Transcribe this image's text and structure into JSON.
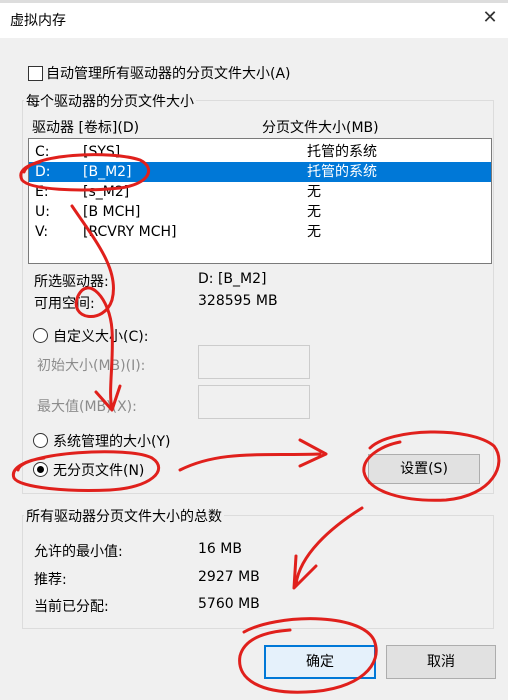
{
  "window": {
    "title": "虚拟内存"
  },
  "auto_manage": {
    "label": "自动管理所有驱动器的分页文件大小(A)",
    "checked": false
  },
  "per_drive_group": {
    "title": "每个驱动器的分页文件大小",
    "header_drive": "驱动器 [卷标](D)",
    "header_size": "分页文件大小(MB)",
    "rows": [
      {
        "drive": "C:",
        "label": "[SYS]",
        "size": "托管的系统"
      },
      {
        "drive": "D:",
        "label": "[B_M2]",
        "size": "托管的系统",
        "selected": true
      },
      {
        "drive": "E:",
        "label": "[s_M2]",
        "size": "无"
      },
      {
        "drive": "U:",
        "label": "[B MCH]",
        "size": "无"
      },
      {
        "drive": "V:",
        "label": "[RCVRY MCH]",
        "size": "无"
      }
    ],
    "selected_drive_label": "所选驱动器:",
    "selected_drive_value": "D:  [B_M2]",
    "free_space_label": "可用空间:",
    "free_space_value": "328595 MB",
    "custom_size_label": "自定义大小(C):",
    "initial_size_label": "初始大小(MB)(I):",
    "max_size_label": "最大值(MB)(X):",
    "system_managed_label": "系统管理的大小(Y)",
    "no_paging_label": "无分页文件(N)",
    "selected_option": "no_paging",
    "set_button": "设置(S)"
  },
  "totals_group": {
    "title": "所有驱动器分页文件大小的总数",
    "min_label": "允许的最小值:",
    "min_value": "16 MB",
    "recommended_label": "推荐:",
    "recommended_value": "2927 MB",
    "current_label": "当前已分配:",
    "current_value": "5760 MB"
  },
  "buttons": {
    "ok": "确定",
    "cancel": "取消"
  },
  "annotation_color": "#e0201c"
}
